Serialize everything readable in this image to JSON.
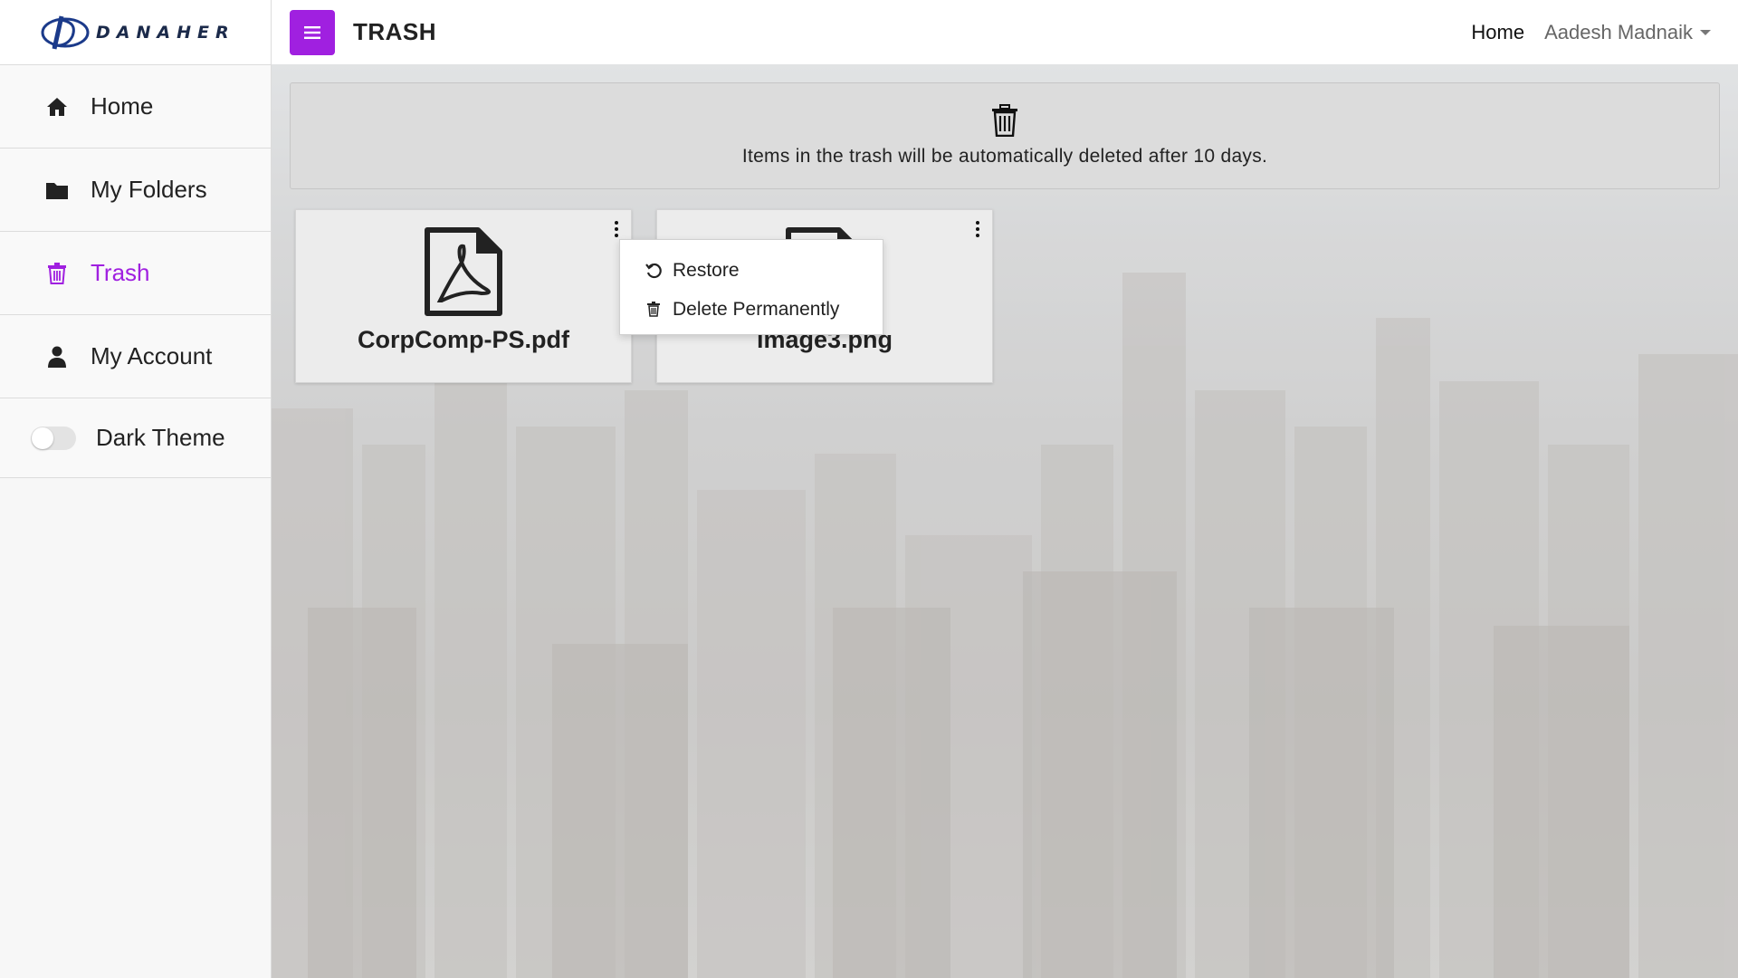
{
  "brand": {
    "logo_text": "DANAHER"
  },
  "sidebar": {
    "items": [
      {
        "label": "Home",
        "icon": "home-icon"
      },
      {
        "label": "My Folders",
        "icon": "folder-icon"
      },
      {
        "label": "Trash",
        "icon": "trash-icon",
        "active": true
      },
      {
        "label": "My Account",
        "icon": "user-icon"
      }
    ],
    "theme_toggle": {
      "label": "Dark Theme",
      "on": false
    }
  },
  "header": {
    "title": "TRASH",
    "home_link": "Home",
    "user_name": "Aadesh Madnaik"
  },
  "notice": {
    "text": "Items in the trash will be automatically deleted after 10 days.",
    "icon": "trash-icon"
  },
  "files": [
    {
      "name": "CorpComp-PS.pdf",
      "icon": "pdf-file-icon"
    },
    {
      "name": "image3.png",
      "icon": "image-file-icon"
    }
  ],
  "context_menu": {
    "items": [
      {
        "label": "Restore",
        "icon": "restore-icon"
      },
      {
        "label": "Delete Permanently",
        "icon": "trash-icon"
      }
    ]
  },
  "colors": {
    "accent": "#a020e0",
    "sidebar_bg": "#f7f7f7",
    "card_bg": "#ececec"
  }
}
